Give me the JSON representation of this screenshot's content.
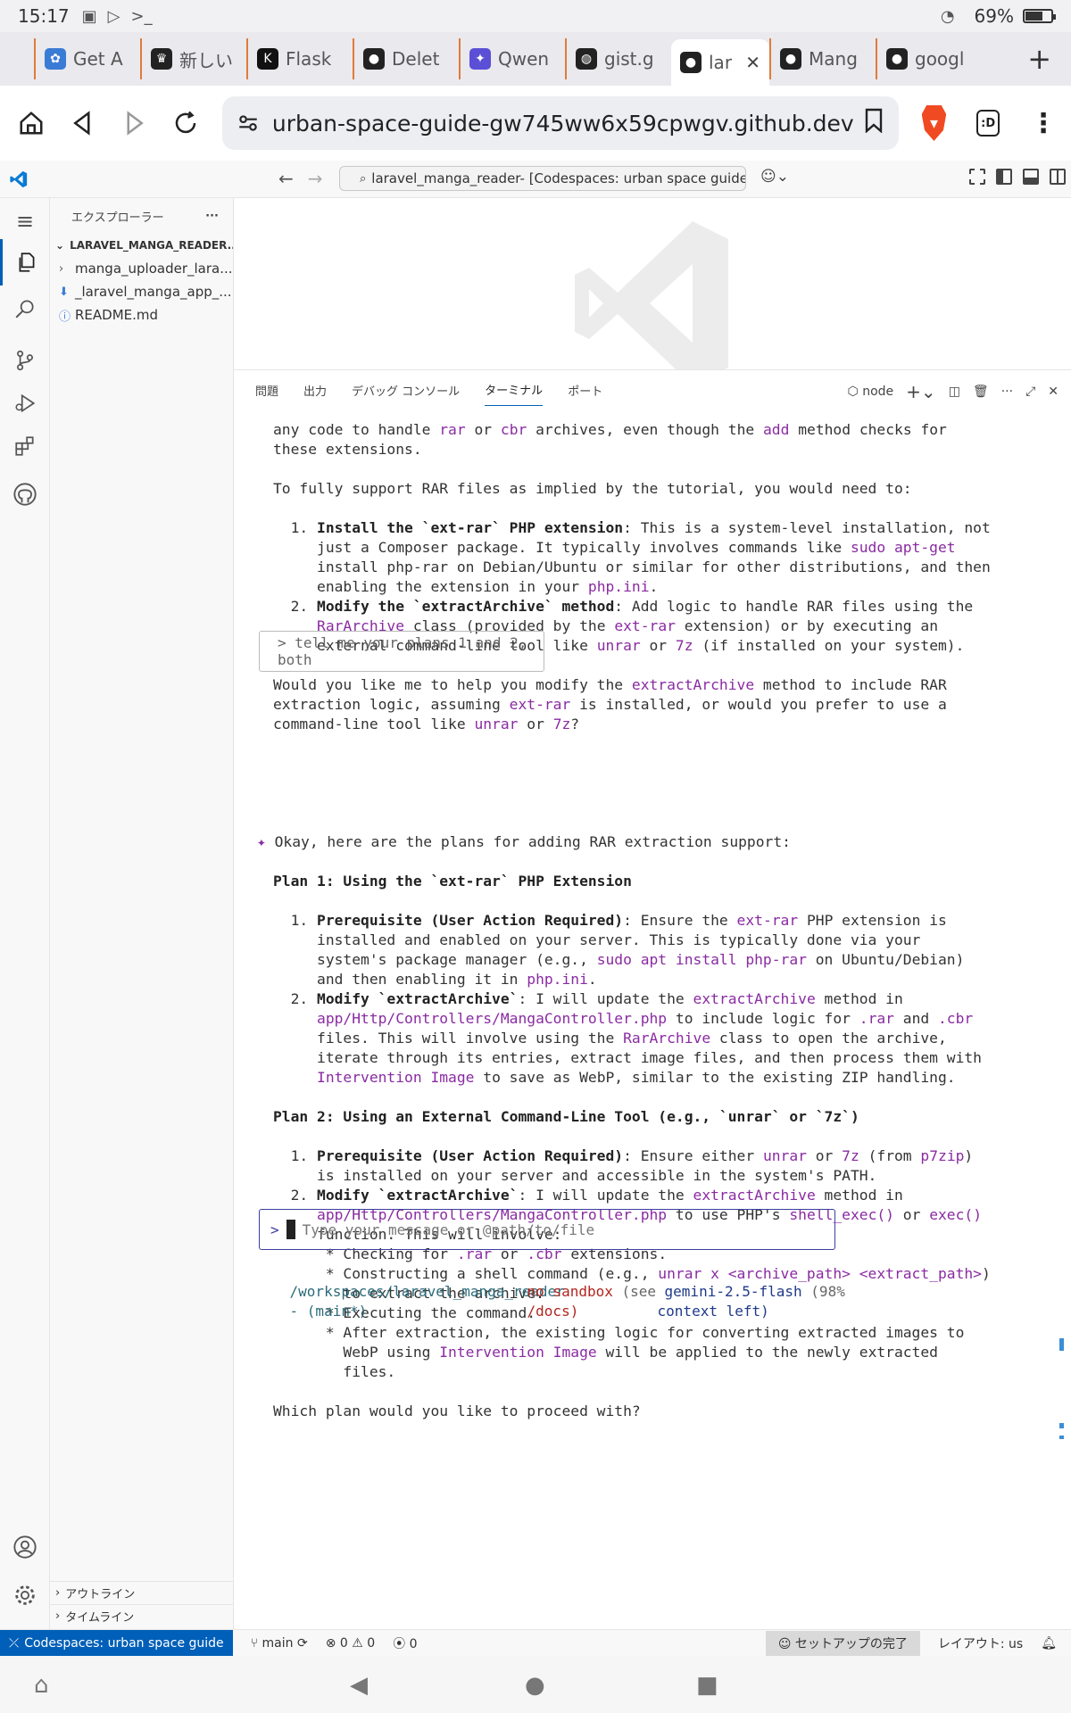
{
  "android": {
    "time": "15:17",
    "battery": "69%",
    "battery_level": 0.69
  },
  "tabs": [
    {
      "label": "Get A",
      "icon": "butterfly-icon",
      "color": "#3a7bd5"
    },
    {
      "label": "新しい",
      "icon": "brave-lion-icon",
      "color": "#222222"
    },
    {
      "label": "Flask",
      "icon": "k-app-icon",
      "color": "#111111"
    },
    {
      "label": "Delet",
      "icon": "github-icon",
      "color": "#222222"
    },
    {
      "label": "Qwen",
      "icon": "qwen-icon",
      "color": "#5b4fd6"
    },
    {
      "label": "gist.g",
      "icon": "globe-icon",
      "color": "#222222"
    },
    {
      "label": "lar",
      "icon": "github-icon",
      "color": "#222222",
      "active": true
    },
    {
      "label": "Mang",
      "icon": "github-icon",
      "color": "#222222"
    },
    {
      "label": "googl",
      "icon": "github-icon",
      "color": "#222222"
    }
  ],
  "browser": {
    "url": "urban-space-guide-gw745ww6x59cpwgv.github.dev",
    "ext_label": ":D"
  },
  "vscode": {
    "command_center": "laravel_manga_reader- [Codespaces: urban space guide]",
    "explorer": {
      "header": "エクスプローラー",
      "root": "LARAVEL_MANGA_READER...",
      "items": [
        {
          "label": "manga_uploader_lara...",
          "icon": "chevron-right-icon"
        },
        {
          "label": "_laravel_manga_app_...",
          "icon": "download-icon"
        },
        {
          "label": "README.md",
          "icon": "info-icon"
        }
      ],
      "outline": "アウトライン",
      "timeline": "タイムライン"
    },
    "panel_tabs": [
      "問題",
      "出力",
      "デバッグ コンソール",
      "ターミナル",
      "ポート"
    ],
    "active_panel_tab": "ターミナル",
    "terminal_name": "node",
    "input_placeholder": "Type your message or @path/to/file",
    "user_prompt": "> tell me your plans 1 and 2, both",
    "footer": {
      "path": "/workspaces/laravel_manga_reader",
      "branch": "- (main*)",
      "sandbox": "no sandbox",
      "sandbox_hint_1": "(see",
      "sandbox_hint_2": "/docs)",
      "model": "gemini-2.5-flash",
      "context_1": "(98%",
      "context_2": "context left)"
    },
    "status": {
      "remote": "Codespaces: urban space guide",
      "branch": "main",
      "errors": "0",
      "warnings": "0",
      "ports": "0",
      "setup": "セットアップの完了",
      "layout": "レイアウト: us"
    }
  }
}
